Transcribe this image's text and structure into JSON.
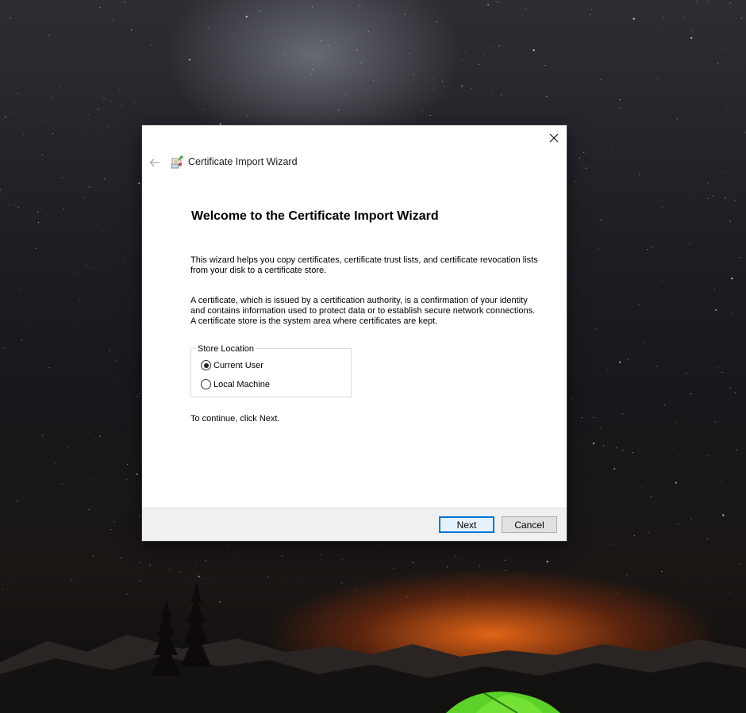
{
  "dialog": {
    "window_title": "Certificate Import Wizard",
    "heading": "Welcome to the Certificate Import Wizard",
    "paragraph1": "This wizard helps you copy certificates, certificate trust lists, and certificate revocation lists from your disk to a certificate store.",
    "paragraph2": "A certificate, which is issued by a certification authority, is a confirmation of your identity and contains information used to protect data or to establish secure network connections. A certificate store is the system area where certificates are kept.",
    "store_location": {
      "legend": "Store Location",
      "options": [
        {
          "label": "Current User",
          "selected": true
        },
        {
          "label": "Local Machine",
          "selected": false
        }
      ]
    },
    "continue_text": "To continue, click Next.",
    "buttons": {
      "next": "Next",
      "cancel": "Cancel"
    },
    "icons": {
      "back": "back-arrow-icon",
      "close": "close-icon",
      "wizard": "certificate-icon"
    },
    "accent_color": "#0078d7"
  }
}
